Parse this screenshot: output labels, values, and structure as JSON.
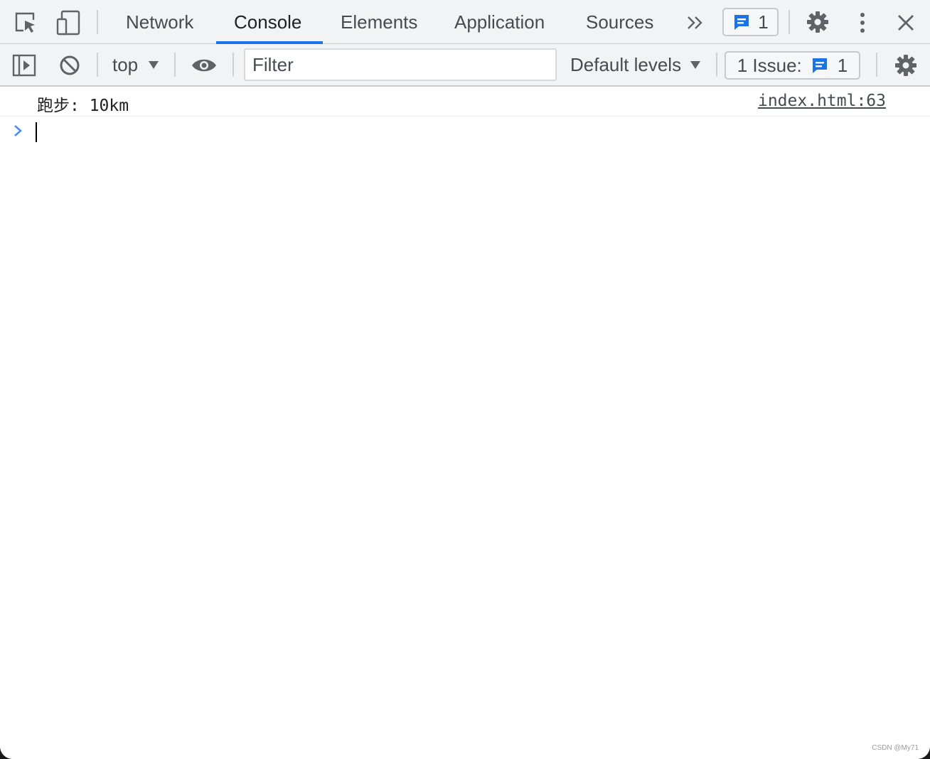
{
  "tabbar": {
    "tabs": [
      {
        "label": "Network"
      },
      {
        "label": "Console"
      },
      {
        "label": "Elements"
      },
      {
        "label": "Application"
      },
      {
        "label": "Sources"
      }
    ],
    "active_tab": "Console",
    "messages_count": "1"
  },
  "toolbar": {
    "context": "top",
    "filter_placeholder": "Filter",
    "filter_value": "",
    "levels_label": "Default levels",
    "issues_label": "1 Issue:",
    "issues_count": "1"
  },
  "console": {
    "messages": [
      {
        "text": "跑步: 10km",
        "source": "index.html:63"
      }
    ],
    "prompt_value": ""
  },
  "watermark": "CSDN @My71",
  "colors": {
    "accent": "#1a73e8",
    "toolbar_bg": "#f1f3f4",
    "prompt_chevron": "#4c8df6"
  }
}
